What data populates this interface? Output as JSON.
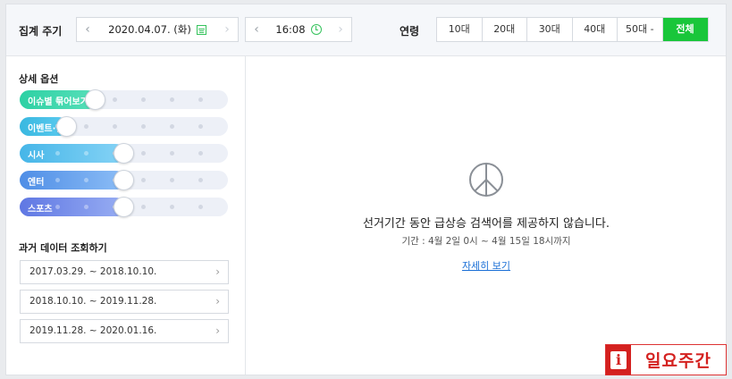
{
  "topbar": {
    "period_label": "집계 주기",
    "date_value": "2020.04.07. (화)",
    "time_value": "16:08",
    "age_label": "연령",
    "age_options": [
      "10대",
      "20대",
      "30대",
      "40대",
      "50대 -",
      "전체"
    ],
    "selected_age": "전체"
  },
  "sidebar": {
    "detail_title": "상세 옵션",
    "sliders": [
      {
        "label": "이슈별 묶어보기",
        "level": 2,
        "color_start": "#2dd1a4",
        "color_end": "#58dfb9"
      },
      {
        "label": "이벤트·할인",
        "level": 1,
        "color_start": "#39b8e0",
        "color_end": "#5ccbf0"
      },
      {
        "label": "시사",
        "level": 3,
        "color_start": "#46b6e8",
        "color_end": "#86d3f6"
      },
      {
        "label": "엔터",
        "level": 3,
        "color_start": "#4f8ee6",
        "color_end": "#8cbdf6"
      },
      {
        "label": "스포츠",
        "level": 3,
        "color_start": "#5f77e3",
        "color_end": "#98aef3"
      }
    ],
    "history_title": "과거 데이터 조회하기",
    "history": [
      "2017.03.29. ~ 2018.10.10.",
      "2018.10.10. ~ 2019.11.28.",
      "2019.11.28. ~ 2020.01.16."
    ]
  },
  "main": {
    "message": "선거기간 동안 급상승 검색어를 제공하지 않습니다.",
    "period": "기간 : 4월 2일 0시 ~ 4월 15일 18시까지",
    "detail_link": "자세히 보기"
  },
  "watermark": {
    "letter": "i",
    "text": "일요주간"
  }
}
